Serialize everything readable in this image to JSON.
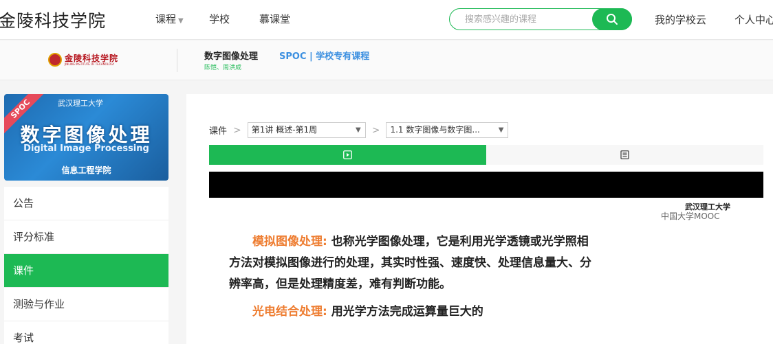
{
  "header": {
    "brand": "金陵科技学院",
    "nav": [
      {
        "label": "课程",
        "has_dropdown": true
      },
      {
        "label": "学校"
      },
      {
        "label": "慕课堂"
      }
    ],
    "search_placeholder": "搜索感兴趣的课程",
    "my_school_cloud": "我的学校云",
    "personal_center": "个人中心"
  },
  "course": {
    "school_logo_text": "金陵科技学院",
    "school_logo_sub": "JINLING INSTITUTE OF TECHNOLOGY",
    "title": "数字图像处理",
    "type": "SPOC | 学校专有课程",
    "teachers": "陈恺、周洪成"
  },
  "cover": {
    "ribbon": "SPOC",
    "university": "武汉理工大学",
    "title": "数字图像处理",
    "subtitle_en": "Digital Image Processing",
    "department": "信息工程学院"
  },
  "sidebar": {
    "items": [
      {
        "label": "公告",
        "active": false
      },
      {
        "label": "评分标准",
        "active": false
      },
      {
        "label": "课件",
        "active": true
      },
      {
        "label": "测验与作业",
        "active": false
      },
      {
        "label": "考试",
        "active": false
      }
    ]
  },
  "content": {
    "breadcrumb_root": "课件",
    "lecture_select": "第1讲 概述-第1周",
    "unit_select": "1.1 数字图像与数字图...",
    "tabs": [
      {
        "icon": "video-icon"
      },
      {
        "icon": "document-icon"
      }
    ],
    "watermark_uni": "武汉理工大学",
    "watermark_mooc": "中国大学MOOC",
    "slide": {
      "p1_heading": "模拟图像处理:",
      "p1_body": "也称光学图像处理，它是利用光学透镜或光学照相方法对模拟图像进行的处理，其实时性强、速度快、处理信息量大、分辨率高，但是处理精度差，难有判断功能。",
      "p2_heading": "光电结合处理:",
      "p2_body": "用光学方法完成运算量巨大的"
    }
  },
  "colors": {
    "accent": "#1db954",
    "link_blue": "#3b8fe0",
    "highlight": "#ee7d31"
  }
}
